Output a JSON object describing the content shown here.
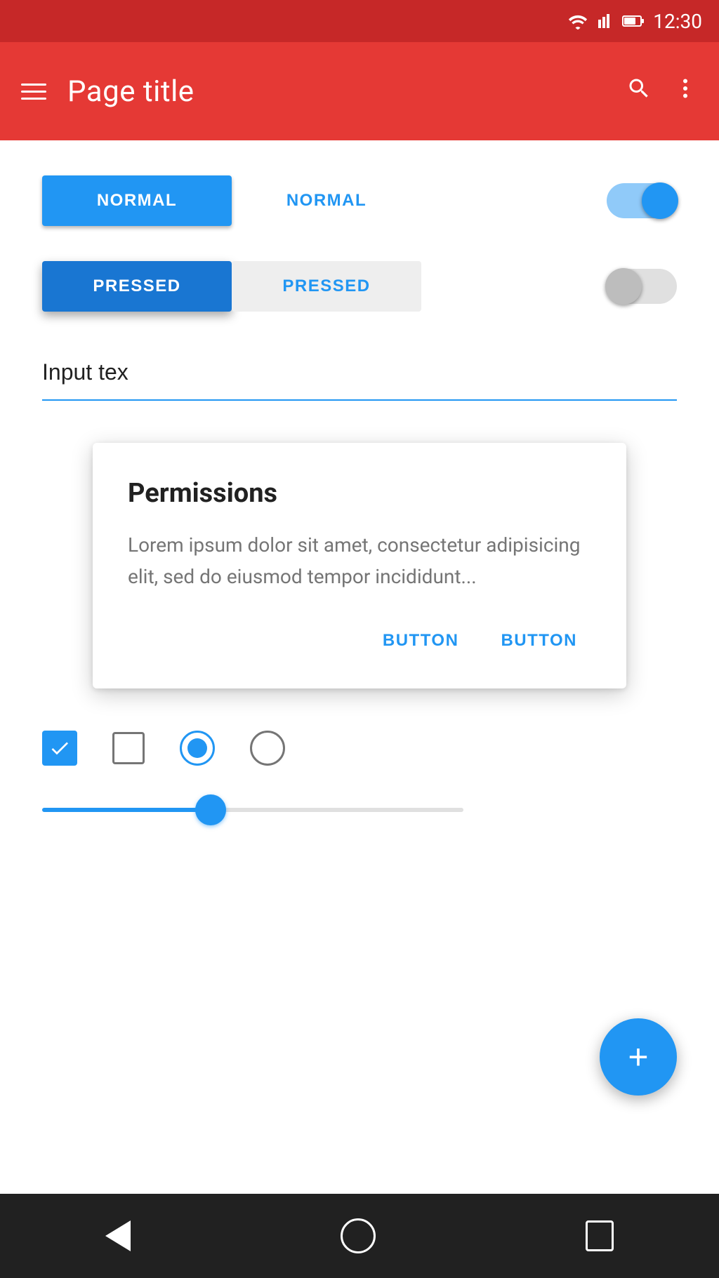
{
  "statusBar": {
    "time": "12:30",
    "wifiIcon": "wifi-icon",
    "signalIcon": "signal-icon",
    "batteryIcon": "battery-icon"
  },
  "appBar": {
    "title": "Page title",
    "menuIcon": "menu-icon",
    "searchIcon": "search-icon",
    "moreIcon": "more-vert-icon"
  },
  "buttons": {
    "normalRaised": "NORMAL",
    "normalFlat": "NORMAL",
    "pressedRaised": "PRESSED",
    "pressedFlat": "PRESSED"
  },
  "toggleNormal": {
    "state": "on"
  },
  "togglePressed": {
    "state": "off"
  },
  "inputField": {
    "value": "Input tex",
    "placeholder": ""
  },
  "dialog": {
    "title": "Permissions",
    "body": "Lorem ipsum dolor sit amet, consectetur adipisicing elit, sed do eiusmod tempor incididunt...",
    "button1": "BUTTON",
    "button2": "BUTTON"
  },
  "controls": {
    "checkbox1State": "checked",
    "checkbox2State": "unchecked",
    "radio1State": "checked",
    "radio2State": "unchecked"
  },
  "slider": {
    "value": 40
  },
  "fab": {
    "icon": "+"
  },
  "navBar": {
    "backIcon": "back-icon",
    "homeIcon": "home-icon",
    "recentIcon": "recent-icon"
  }
}
